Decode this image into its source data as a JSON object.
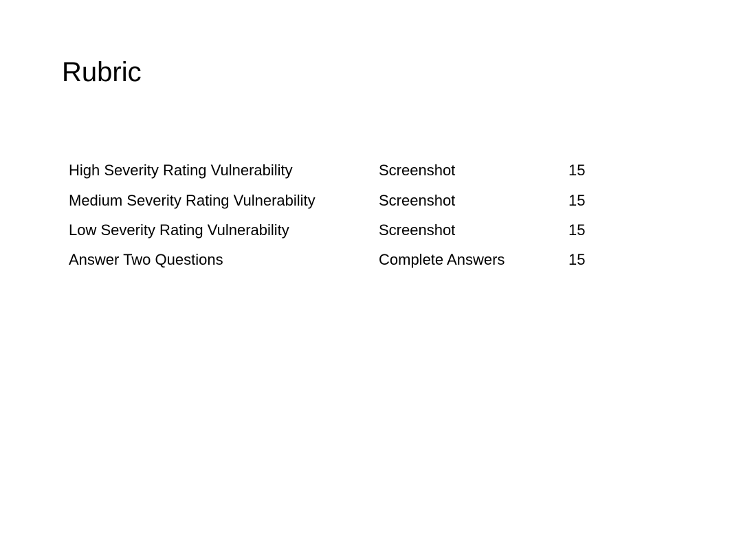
{
  "slide": {
    "title": "Rubric",
    "rows": [
      {
        "item": "High Severity Rating Vulnerability",
        "requirement": "Screenshot",
        "points": "15"
      },
      {
        "item": "Medium Severity Rating Vulnerability",
        "requirement": "Screenshot",
        "points": "15"
      },
      {
        "item": "Low Severity Rating Vulnerability",
        "requirement": "Screenshot",
        "points": "15"
      },
      {
        "item": "Answer Two Questions",
        "requirement": "Complete Answers",
        "points": "15"
      }
    ]
  }
}
